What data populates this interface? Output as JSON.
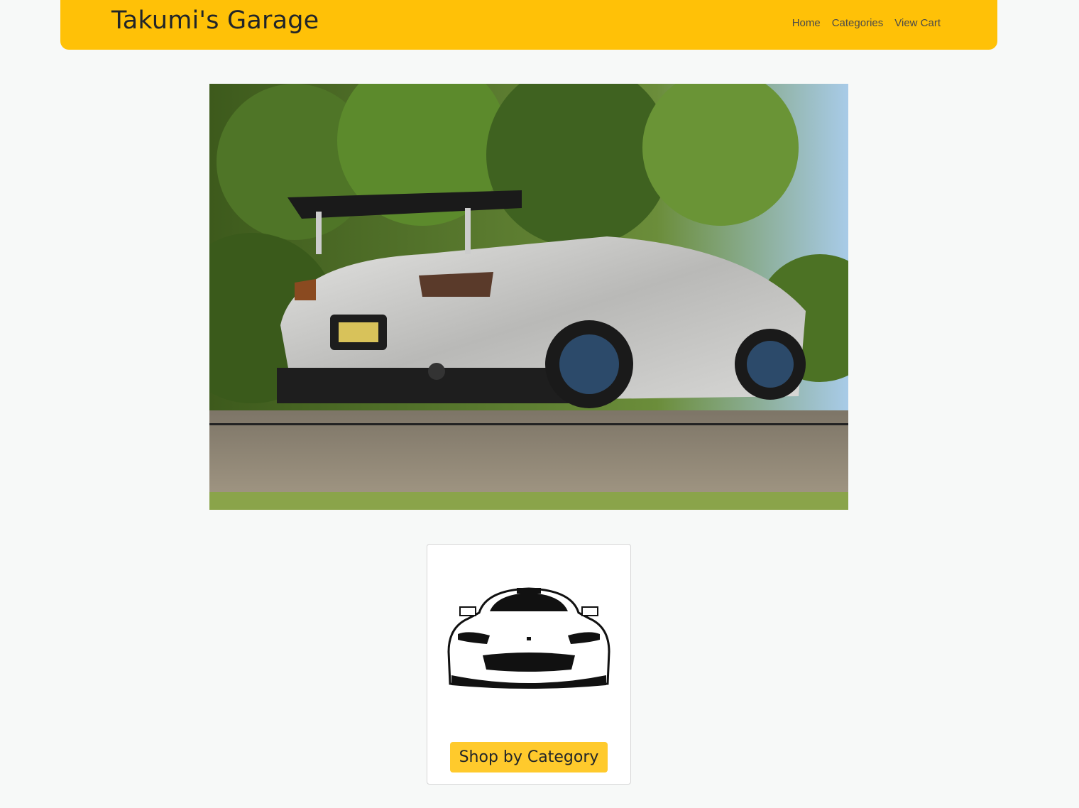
{
  "header": {
    "brand": "Takumi's Garage",
    "nav": [
      "Home",
      "Categories",
      "View Cart"
    ]
  },
  "card": {
    "button_label": "Shop by Category"
  },
  "colors": {
    "navbar": "#ffc107",
    "button": "#ffca2c",
    "background": "#f7f9f8"
  }
}
